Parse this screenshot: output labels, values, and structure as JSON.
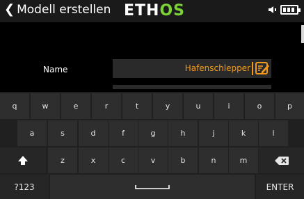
{
  "header": {
    "title": "Modell erstellen",
    "logo": {
      "part1": "ETH",
      "part2": "OS"
    }
  },
  "form": {
    "name_label": "Name",
    "name_value": "Hafenschlepper"
  },
  "keyboard": {
    "row1": [
      "q",
      "w",
      "e",
      "r",
      "t",
      "y",
      "u",
      "i",
      "o",
      "p"
    ],
    "row2": [
      "a",
      "s",
      "d",
      "f",
      "g",
      "h",
      "j",
      "k",
      "l"
    ],
    "row3": [
      "z",
      "x",
      "c",
      "v",
      "b",
      "n",
      "m"
    ],
    "mode_key": "?123",
    "enter_key": "ENTER"
  },
  "colors": {
    "accent": "#f39a1b",
    "logo_green": "#7cd134",
    "background": "#000000",
    "keyboard": "#202020"
  }
}
